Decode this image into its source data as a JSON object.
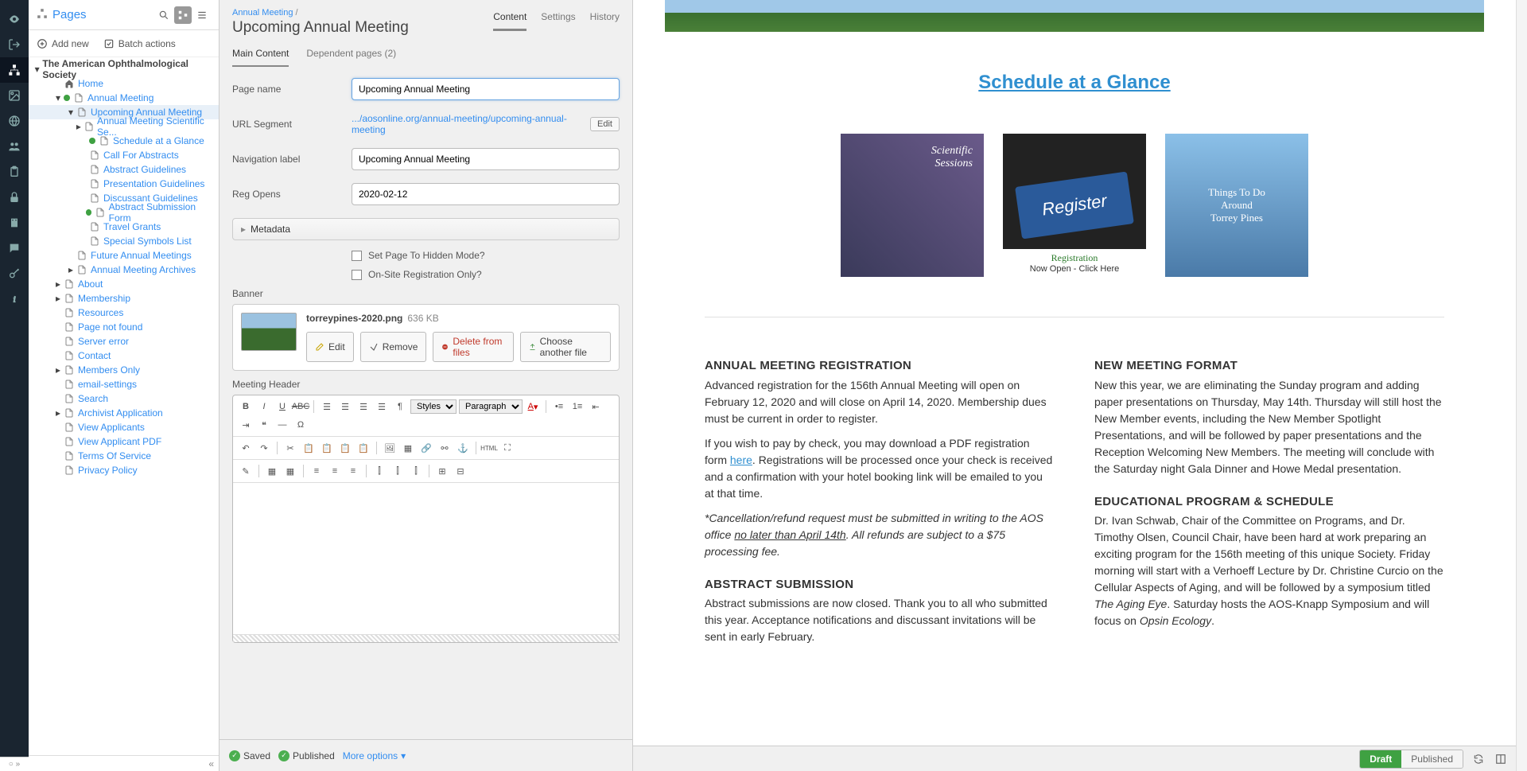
{
  "rail": {
    "items": [
      "eye",
      "logout",
      "sitemap",
      "photo",
      "globe",
      "people",
      "clipboard",
      "lock",
      "building",
      "chat",
      "key",
      "info"
    ]
  },
  "leftPanel": {
    "title": "Pages",
    "actions": {
      "add": "Add new",
      "batch": "Batch actions"
    },
    "treeRoot": "The American Ophthalmological Society",
    "tree": [
      {
        "d": 1,
        "a": "",
        "i": "home",
        "t": "Home"
      },
      {
        "d": 1,
        "a": "down",
        "i": "page",
        "t": "Annual Meeting",
        "bullet": true
      },
      {
        "d": 2,
        "a": "down",
        "i": "page",
        "t": "Upcoming Annual Meeting",
        "sel": true
      },
      {
        "d": 3,
        "a": "right",
        "i": "page",
        "t": "Annual Meeting Scientific Se..."
      },
      {
        "d": 3,
        "a": "",
        "i": "page",
        "t": "Schedule at a Glance",
        "bullet": true
      },
      {
        "d": 3,
        "a": "",
        "i": "page",
        "t": "Call For Abstracts"
      },
      {
        "d": 3,
        "a": "",
        "i": "page",
        "t": "Abstract Guidelines"
      },
      {
        "d": 3,
        "a": "",
        "i": "page",
        "t": "Presentation Guidelines"
      },
      {
        "d": 3,
        "a": "",
        "i": "page",
        "t": "Discussant Guidelines"
      },
      {
        "d": 3,
        "a": "",
        "i": "page",
        "t": "Abstract Submission Form",
        "bullet": true
      },
      {
        "d": 3,
        "a": "",
        "i": "page",
        "t": "Travel Grants"
      },
      {
        "d": 3,
        "a": "",
        "i": "page",
        "t": "Special Symbols List"
      },
      {
        "d": 2,
        "a": "",
        "i": "page",
        "t": "Future Annual Meetings"
      },
      {
        "d": 2,
        "a": "right",
        "i": "page",
        "t": "Annual Meeting Archives"
      },
      {
        "d": 1,
        "a": "right",
        "i": "page",
        "t": "About"
      },
      {
        "d": 1,
        "a": "right",
        "i": "page",
        "t": "Membership"
      },
      {
        "d": 1,
        "a": "",
        "i": "page",
        "t": "Resources"
      },
      {
        "d": 1,
        "a": "",
        "i": "page",
        "t": "Page not found"
      },
      {
        "d": 1,
        "a": "",
        "i": "page",
        "t": "Server error"
      },
      {
        "d": 1,
        "a": "",
        "i": "page",
        "t": "Contact"
      },
      {
        "d": 1,
        "a": "right",
        "i": "page",
        "t": "Members Only"
      },
      {
        "d": 1,
        "a": "",
        "i": "page",
        "t": "email-settings"
      },
      {
        "d": 1,
        "a": "",
        "i": "page",
        "t": "Search"
      },
      {
        "d": 1,
        "a": "right",
        "i": "page",
        "t": "Archivist Application"
      },
      {
        "d": 1,
        "a": "",
        "i": "page",
        "t": "View Applicants"
      },
      {
        "d": 1,
        "a": "",
        "i": "page",
        "t": "View Applicant PDF"
      },
      {
        "d": 1,
        "a": "",
        "i": "page",
        "t": "Terms Of Service"
      },
      {
        "d": 1,
        "a": "",
        "i": "page",
        "t": "Privacy Policy"
      }
    ]
  },
  "mid": {
    "breadcrumb": "Annual Meeting",
    "title": "Upcoming Annual Meeting",
    "tabs": [
      "Content",
      "Settings",
      "History"
    ],
    "subtabs": [
      "Main Content",
      "Dependent pages (2)"
    ],
    "fields": {
      "pageNameLabel": "Page name",
      "pageNameVal": "Upcoming Annual Meeting",
      "urlLabel": "URL Segment",
      "urlVal": ".../aosonline.org/annual-meeting/upcoming-annual-meeting",
      "editBtn": "Edit",
      "navLabel": "Navigation label",
      "navVal": "Upcoming Annual Meeting",
      "regLabel": "Reg Opens",
      "regVal": "2020-02-12",
      "metadata": "Metadata",
      "chk1": "Set Page To Hidden Mode?",
      "chk2": "On-Site Registration Only?"
    },
    "banner": {
      "label": "Banner",
      "filename": "torreypines-2020.png",
      "filesize": "636 KB",
      "edit": "Edit",
      "remove": "Remove",
      "deleteFiles": "Delete from files",
      "choose": "Choose another file"
    },
    "header": {
      "label": "Meeting Header",
      "styles": "Styles",
      "paragraph": "Paragraph"
    },
    "footer": {
      "saved": "Saved",
      "published": "Published",
      "more": "More options"
    }
  },
  "right": {
    "scheduleLink": "Schedule at a Glance",
    "card1a": "Scientific",
    "card1b": "Sessions",
    "card2": "Register",
    "card2sub1": "Registration",
    "card2sub2": "Now Open - Click Here",
    "card3a": "Things To Do",
    "card3b": "Around",
    "card3c": "Torrey Pines",
    "col1": {
      "h1": "ANNUAL MEETING REGISTRATION",
      "p1": "Advanced registration for the 156th Annual Meeting will open on February 12, 2020 and will close on April 14, 2020. Membership dues must be current in order to register.",
      "p2a": "If you wish to pay by check, you may download a PDF registration form ",
      "p2link": "here",
      "p2b": ". Registrations will be processed once your check is received and a confirmation with your hotel booking link will be emailed to you at that time.",
      "p3a": "*Cancellation/refund request must be submitted in writing to the AOS office ",
      "p3u": "no later than April 14th",
      "p3b": ". All refunds are subject to a $75 processing fee.",
      "h2": "ABSTRACT SUBMISSION",
      "p4": "Abstract submissions are now closed. Thank you to all who submitted this year. Acceptance notifications and discussant invitations will be sent in early February."
    },
    "col2": {
      "h1": "NEW MEETING FORMAT",
      "p1": "New this year, we are eliminating the Sunday program and adding paper presentations on Thursday, May 14th. Thursday will still host the New Member events, including the New Member Spotlight Presentations, and will be followed by paper presentations and the Reception Welcoming New Members. The meeting will conclude with the Saturday night Gala Dinner and Howe Medal presentation.",
      "h2": "EDUCATIONAL PROGRAM & SCHEDULE",
      "p2a": "Dr. Ivan Schwab, Chair of the Committee on Programs, and Dr. Timothy Olsen, Council Chair, have been hard at work preparing an exciting program for the 156th meeting of this unique Society. Friday morning will start with a Verhoeff Lecture by Dr. Christine Curcio on the Cellular Aspects of Aging, and will be followed by a symposium titled ",
      "p2i1": "The Aging Eye",
      "p2b": ". Saturday hosts the AOS-Knapp Symposium and will focus on ",
      "p2i2": "Opsin Ecology",
      "p2c": "."
    },
    "draft": "Draft",
    "pub": "Published"
  }
}
